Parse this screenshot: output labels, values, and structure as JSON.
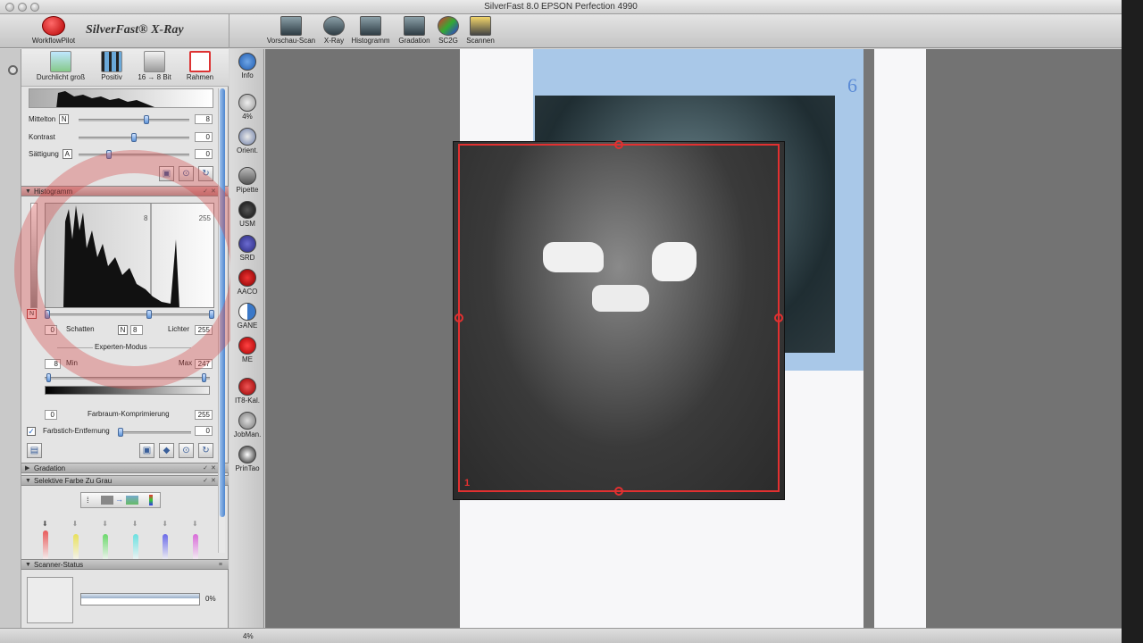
{
  "window": {
    "title": "SilverFast 8.0 EPSON Perfection 4990"
  },
  "brand": {
    "workflowpilot": "WorkflowPilot",
    "name": "SilverFast® X-Ray"
  },
  "toolbar": [
    {
      "label": "Vorschau-Scan",
      "icon": "preview-scan-icon"
    },
    {
      "label": "X-Ray",
      "icon": "xray-icon"
    },
    {
      "label": "Histogramm",
      "icon": "histogram-icon"
    },
    {
      "label": "Gradation",
      "icon": "gradation-icon"
    },
    {
      "label": "SC2G",
      "icon": "sc2g-icon"
    },
    {
      "label": "Scannen",
      "icon": "scan-icon"
    }
  ],
  "top_tools": [
    {
      "label": "Durchlicht groß",
      "icon": "transparency-icon"
    },
    {
      "label": "Positiv",
      "icon": "film-positive-icon"
    },
    {
      "label": "16 → 8 Bit",
      "icon": "bit-depth-icon"
    },
    {
      "label": "Rahmen",
      "icon": "frame-tool-icon"
    }
  ],
  "adjust": {
    "mittelton": {
      "label": "Mittelton",
      "mode": "N",
      "value": "8",
      "level": 0.62
    },
    "kontrast": {
      "label": "Kontrast",
      "value": "0",
      "level": 0.5
    },
    "saettigung": {
      "label": "Sättigung",
      "mode": "A",
      "value": "0",
      "level": 0.26
    }
  },
  "histogram": {
    "header": "Histogramm",
    "scale_min": "0",
    "scale_mid": "8",
    "scale_max": "255",
    "schatten_label": "Schatten",
    "schatten_value": "0",
    "mode": "N",
    "mid_value": "8",
    "lichter_label": "Lichter",
    "lichter_value": "255",
    "experten": "Experten-Modus",
    "min_label": "Min",
    "min_value": "8",
    "max_label": "Max",
    "max_value": "247",
    "farbraum_label": "Farbraum-Komprimierung",
    "farbraum_min": "0",
    "farbraum_max": "255",
    "farbstich_label": "Farbstich-Entfernung",
    "farbstich_value": "0",
    "farbstich_checked": true,
    "channel": "N"
  },
  "sections": {
    "gradation": "Gradation",
    "selektive": "Selektive Farbe Zu Grau",
    "scanner_status": "Scanner-Status"
  },
  "scanner": {
    "progress_text": "0%",
    "progress": 0
  },
  "vtools": [
    {
      "label": "Info",
      "icon": "info-icon"
    },
    {
      "label": "4%",
      "icon": "zoom-icon"
    },
    {
      "label": "Orient.",
      "icon": "orientation-icon"
    },
    {
      "label": "Pipette",
      "icon": "pipette-icon"
    },
    {
      "label": "USM",
      "icon": "usm-icon"
    },
    {
      "label": "SRD",
      "icon": "srd-icon"
    },
    {
      "label": "AACO",
      "icon": "aaco-icon"
    },
    {
      "label": "GANE",
      "icon": "gane-icon"
    },
    {
      "label": "ME",
      "icon": "me-icon"
    },
    {
      "label": "IT8-Kal.",
      "icon": "it8-icon"
    },
    {
      "label": "JobMan.",
      "icon": "jobmanager-icon"
    },
    {
      "label": "PrinTao",
      "icon": "printao-icon"
    }
  ],
  "canvas": {
    "film_number": "6",
    "frame_number": "1"
  },
  "status": {
    "zoom": "4%"
  },
  "colors": {
    "accent": "#4d86d0",
    "frame": "#e23030",
    "film": "#a9c8e8"
  }
}
